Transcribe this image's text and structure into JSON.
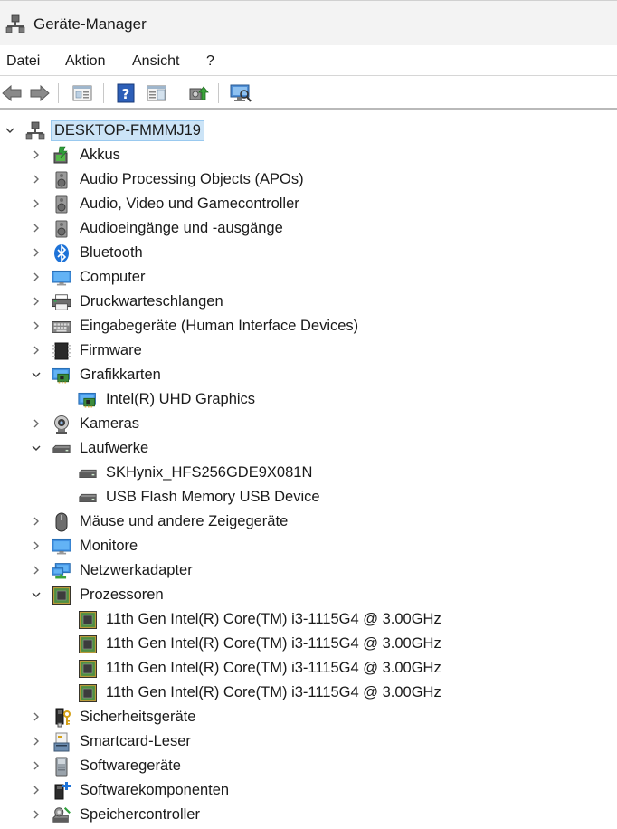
{
  "window": {
    "title": "Geräte-Manager"
  },
  "menu": [
    {
      "label": "Datei"
    },
    {
      "label": "Aktion"
    },
    {
      "label": "Ansicht"
    },
    {
      "label": "?"
    }
  ],
  "toolbar": {
    "buttons": [
      "back-arrow-icon",
      "forward-arrow-icon",
      "properties-icon",
      "help-icon",
      "action-pane-icon",
      "update-driver-icon",
      "scan-hardware-icon"
    ]
  },
  "tree": {
    "root": {
      "label": "DESKTOP-FMMMJ19",
      "icon": "computer-network-icon"
    },
    "categories": [
      {
        "label": "Akkus",
        "icon": "battery-icon",
        "expanded": false,
        "children": []
      },
      {
        "label": "Audio Processing Objects (APOs)",
        "icon": "speaker-icon",
        "expanded": false,
        "children": []
      },
      {
        "label": "Audio, Video und Gamecontroller",
        "icon": "speaker-icon",
        "expanded": false,
        "children": []
      },
      {
        "label": "Audioeingänge und -ausgänge",
        "icon": "speaker-icon",
        "expanded": false,
        "children": []
      },
      {
        "label": "Bluetooth",
        "icon": "bluetooth-icon",
        "expanded": false,
        "children": []
      },
      {
        "label": "Computer",
        "icon": "monitor-icon",
        "expanded": false,
        "children": []
      },
      {
        "label": "Druckwarteschlangen",
        "icon": "printer-icon",
        "expanded": false,
        "children": []
      },
      {
        "label": "Eingabegeräte (Human Interface Devices)",
        "icon": "keyboard-icon",
        "expanded": false,
        "children": []
      },
      {
        "label": "Firmware",
        "icon": "firmware-icon",
        "expanded": false,
        "children": []
      },
      {
        "label": "Grafikkarten",
        "icon": "display-adapter-icon",
        "expanded": true,
        "children": [
          {
            "label": "Intel(R) UHD Graphics",
            "icon": "display-adapter-icon"
          }
        ]
      },
      {
        "label": "Kameras",
        "icon": "webcam-icon",
        "expanded": false,
        "children": []
      },
      {
        "label": "Laufwerke",
        "icon": "drive-icon",
        "expanded": true,
        "children": [
          {
            "label": "SKHynix_HFS256GDE9X081N",
            "icon": "drive-icon"
          },
          {
            "label": "USB Flash Memory USB Device",
            "icon": "drive-icon"
          }
        ]
      },
      {
        "label": "Mäuse und andere Zeigegeräte",
        "icon": "mouse-icon",
        "expanded": false,
        "children": []
      },
      {
        "label": "Monitore",
        "icon": "monitor-icon",
        "expanded": false,
        "children": []
      },
      {
        "label": "Netzwerkadapter",
        "icon": "network-adapter-icon",
        "expanded": false,
        "children": []
      },
      {
        "label": "Prozessoren",
        "icon": "processor-icon",
        "expanded": true,
        "children": [
          {
            "label": "11th Gen Intel(R) Core(TM) i3-1115G4 @ 3.00GHz",
            "icon": "processor-icon"
          },
          {
            "label": "11th Gen Intel(R) Core(TM) i3-1115G4 @ 3.00GHz",
            "icon": "processor-icon"
          },
          {
            "label": "11th Gen Intel(R) Core(TM) i3-1115G4 @ 3.00GHz",
            "icon": "processor-icon"
          },
          {
            "label": "11th Gen Intel(R) Core(TM) i3-1115G4 @ 3.00GHz",
            "icon": "processor-icon"
          }
        ]
      },
      {
        "label": "Sicherheitsgeräte",
        "icon": "security-key-icon",
        "expanded": false,
        "children": []
      },
      {
        "label": "Smartcard-Leser",
        "icon": "smartcard-reader-icon",
        "expanded": false,
        "children": []
      },
      {
        "label": "Softwaregeräte",
        "icon": "software-device-icon",
        "expanded": false,
        "children": []
      },
      {
        "label": "Softwarekomponenten",
        "icon": "software-component-icon",
        "expanded": false,
        "children": []
      },
      {
        "label": "Speichercontroller",
        "icon": "storage-controller-icon",
        "expanded": false,
        "children": []
      }
    ]
  },
  "colors": {
    "selection": "#cce4f7",
    "selection_border": "#99c9ef"
  }
}
